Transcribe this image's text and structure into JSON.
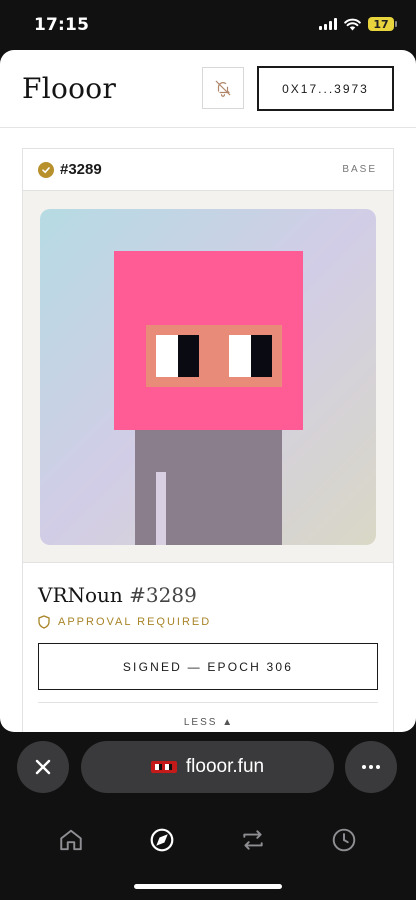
{
  "status": {
    "time": "17:15",
    "battery": "17"
  },
  "app": {
    "logo": "Flooor",
    "wallet_label": "0X17...3973",
    "icons": {
      "bell": "bell-off-icon"
    }
  },
  "card": {
    "token_id": "#3289",
    "chain": "BASE",
    "title_name": "VRNoun",
    "title_number": "#3289",
    "approval": "APPROVAL REQUIRED",
    "signed_label": "SIGNED — EPOCH 306",
    "less_label": "LESS ▲",
    "nft": {
      "head_color": "#ff5c96",
      "glasses_color": "#e88b78",
      "body_color": "#8a7e8c"
    }
  },
  "browser": {
    "url": "flooor.fun",
    "icons": {
      "close": "close-icon",
      "more": "more-icon"
    }
  },
  "tabs": [
    {
      "name": "home",
      "icon": "home-icon"
    },
    {
      "name": "explore",
      "icon": "compass-icon"
    },
    {
      "name": "swap",
      "icon": "swap-icon"
    },
    {
      "name": "history",
      "icon": "clock-icon"
    }
  ],
  "colors": {
    "accent_gold": "#b8912d",
    "dark": "#111111"
  }
}
